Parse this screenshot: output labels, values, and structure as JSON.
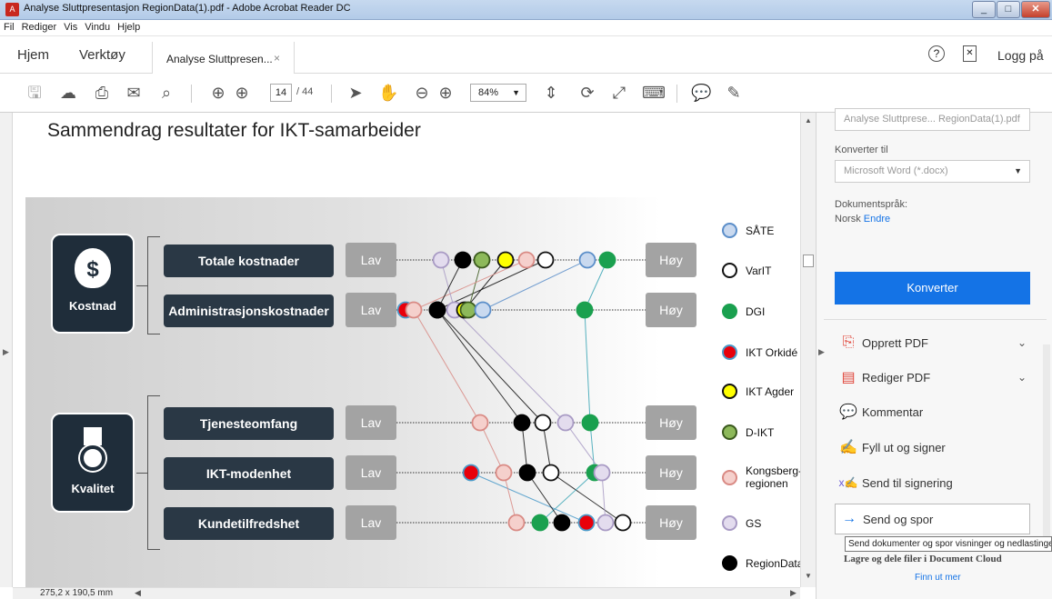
{
  "window": {
    "title": "Analyse Sluttpresentasjon RegionData(1).pdf - Adobe Acrobat Reader DC"
  },
  "menu": [
    "Fil",
    "Rediger",
    "Vis",
    "Vindu",
    "Hjelp"
  ],
  "tabs": {
    "home": "Hjem",
    "tools": "Verktøy",
    "doc": "Analyse Sluttpresen...",
    "close": "×",
    "login": "Logg på"
  },
  "toolbar": {
    "page": "14",
    "page_total": "/ 44",
    "zoom": "84%"
  },
  "slide": {
    "title": "Sammendrag resultater for IKT-samarbeider",
    "categories": [
      {
        "label": "Kostnad",
        "icon": "money-bag-icon"
      },
      {
        "label": "Kvalitet",
        "icon": "medal-icon"
      }
    ],
    "rows": [
      "Totale kostnader",
      "Administrasjonskostnader",
      "Tjenesteomfang",
      "IKT-modenhet",
      "Kundetilfredshet"
    ],
    "low": "Lav",
    "high": "Høy",
    "legend": [
      {
        "label": "SÅTE",
        "color": "#c9d9ef",
        "border": "#5b8ec9"
      },
      {
        "label": "VarIT",
        "color": "#ffffff",
        "border": "#111111"
      },
      {
        "label": "DGI",
        "color": "#1aa04f",
        "border": "#1aa04f"
      },
      {
        "label": "IKT Orkidé",
        "color": "#e8000b",
        "border": "#4a9ac9"
      },
      {
        "label": "IKT Agder",
        "color": "#ffff00",
        "border": "#111111"
      },
      {
        "label": "D-IKT",
        "color": "#8db95a",
        "border": "#3b5a1e"
      },
      {
        "label": "Kongsberg-\nregionen",
        "color": "#f5d0cc",
        "border": "#d98a84"
      },
      {
        "label": "GS",
        "color": "#e3dcee",
        "border": "#a89ac4"
      },
      {
        "label": "RegionData",
        "color": "#000000",
        "border": "#000000"
      }
    ]
  },
  "right_panel": {
    "file_field": "Analyse Sluttprese... RegionData(1).pdf",
    "convert_to_label": "Konverter til",
    "format_select": "Microsoft Word (*.docx)",
    "doc_lang_label": "Dokumentspråk:",
    "doc_lang": "Norsk",
    "change_link": "Endre",
    "convert_button": "Konverter",
    "tools": [
      "Opprett PDF",
      "Rediger PDF",
      "Kommentar",
      "Fyll ut og signer",
      "Send til signering",
      "Send og spor"
    ],
    "tooltip": "Send dokumenter og spor visninger og nedlastinger",
    "cloud_text": "Lagre og dele filer i Document Cloud",
    "learn_more": "Finn ut mer"
  },
  "status": {
    "page_size": "275,2 x 190,5 mm"
  }
}
